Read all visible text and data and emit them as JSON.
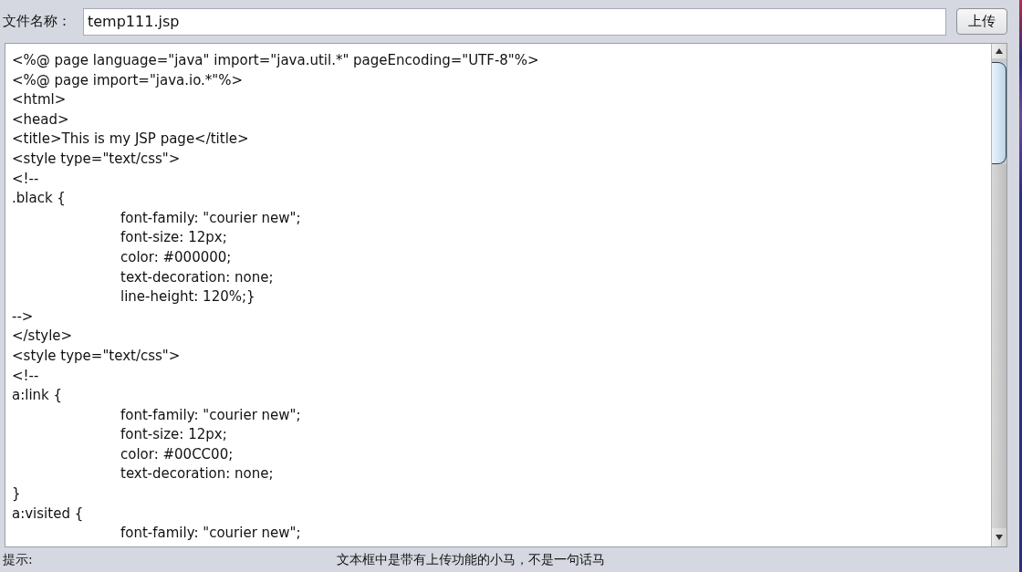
{
  "file_name": {
    "label": "文件名称：",
    "value": "temp111.jsp"
  },
  "upload_button": {
    "label": "上传"
  },
  "editor": {
    "lines": [
      {
        "text": "<%@ page language=\"java\" import=\"java.util.*\" pageEncoding=\"UTF-8\"%>"
      },
      {
        "text": "<%@ page import=\"java.io.*\"%>"
      },
      {
        "text": "<html>"
      },
      {
        "text": "<head>"
      },
      {
        "text": "<title>This is my JSP page</title>"
      },
      {
        "text": "<style type=\"text/css\">"
      },
      {
        "text": "<!--"
      },
      {
        "text": ".black {",
        "children": [
          {
            "text": "font-family: \"courier new\";"
          },
          {
            "text": "font-size: 12px;"
          },
          {
            "text": "color: #000000;"
          },
          {
            "text": "text-decoration: none;"
          },
          {
            "text": "line-height: 120%;}"
          }
        ]
      },
      {
        "text": "-->"
      },
      {
        "text": "</style>"
      },
      {
        "text": "<style type=\"text/css\">"
      },
      {
        "text": "<!--"
      },
      {
        "text": "a:link {",
        "children": [
          {
            "text": "font-family: \"courier new\";"
          },
          {
            "text": "font-size: 12px;"
          },
          {
            "text": "color: #00CC00;"
          },
          {
            "text": "text-decoration: none;"
          }
        ]
      },
      {
        "text": "}"
      },
      {
        "text": "a:visited {",
        "children": [
          {
            "text": "font-family: \"courier new\";"
          }
        ]
      }
    ]
  },
  "status_bar": {
    "hint_label": "提示:",
    "message": "文本框中是带有上传功能的小马，不是一句话马"
  }
}
